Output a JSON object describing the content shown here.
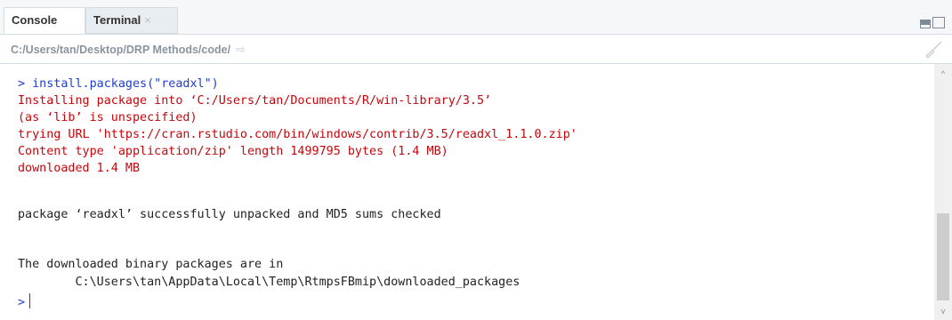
{
  "tabs": [
    {
      "label": "Console",
      "active": true
    },
    {
      "label": "Terminal",
      "close": "×",
      "active": false
    }
  ],
  "path_bar": {
    "path": "C:/Users/tan/Desktop/DRP Methods/code/",
    "go_icon": "⇨"
  },
  "console_lines": [
    {
      "text": "> install.packages(\"readxl\")",
      "kind": "input"
    },
    {
      "text": "Installing package into ‘C:/Users/tan/Documents/R/win-library/3.5’",
      "kind": "message"
    },
    {
      "text": "(as ‘lib’ is unspecified)",
      "kind": "message"
    },
    {
      "text": "trying URL 'https://cran.rstudio.com/bin/windows/contrib/3.5/readxl_1.1.0.zip'",
      "kind": "message"
    },
    {
      "text": "Content type 'application/zip' length 1499795 bytes (1.4 MB)",
      "kind": "message"
    },
    {
      "text": "downloaded 1.4 MB",
      "kind": "message"
    },
    {
      "text": "package ‘readxl’ successfully unpacked and MD5 sums checked",
      "kind": "output"
    },
    {
      "text": "The downloaded binary packages are in",
      "kind": "output"
    },
    {
      "text": "        C:\\Users\\tan\\AppData\\Local\\Temp\\RtmpsFBmip\\downloaded_packages",
      "kind": "output"
    }
  ],
  "prompt": ">",
  "colors": {
    "input": "#1f3dcc",
    "message": "#c5060b",
    "output": "#222222"
  },
  "scroll": {
    "up_arrow": "^",
    "down_arrow": "v"
  }
}
